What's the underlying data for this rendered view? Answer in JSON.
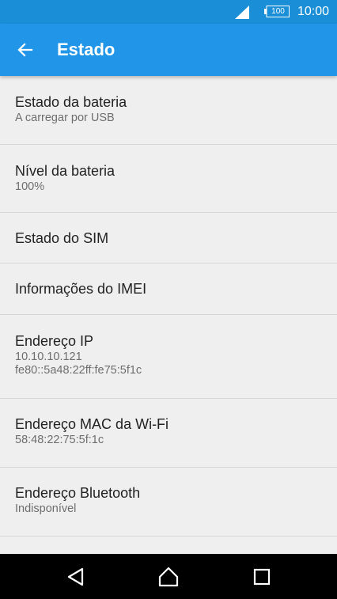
{
  "status_bar": {
    "battery": "100",
    "time": "10:00"
  },
  "app_bar": {
    "title": "Estado"
  },
  "items": [
    {
      "title": "Estado da bateria",
      "subtitle": "A carregar por USB"
    },
    {
      "title": "Nível da bateria",
      "subtitle": "100%"
    },
    {
      "title": "Estado do SIM"
    },
    {
      "title": "Informações do IMEI"
    },
    {
      "title": "Endereço IP",
      "subtitle_lines": [
        "10.10.10.121",
        "fe80::5a48:22ff:fe75:5f1c"
      ]
    },
    {
      "title": "Endereço MAC da Wi-Fi",
      "subtitle": "58:48:22:75:5f:1c"
    },
    {
      "title": "Endereço Bluetooth",
      "subtitle": "Indisponível"
    }
  ],
  "icons": {
    "back": "arrow-left-icon",
    "nav": [
      "back-triangle-icon",
      "home-icon",
      "recents-square-icon"
    ]
  },
  "colors": {
    "status_bar": "#1a8fd7",
    "app_bar": "#2196e8",
    "background": "#efefef",
    "nav_bar": "#000000"
  }
}
